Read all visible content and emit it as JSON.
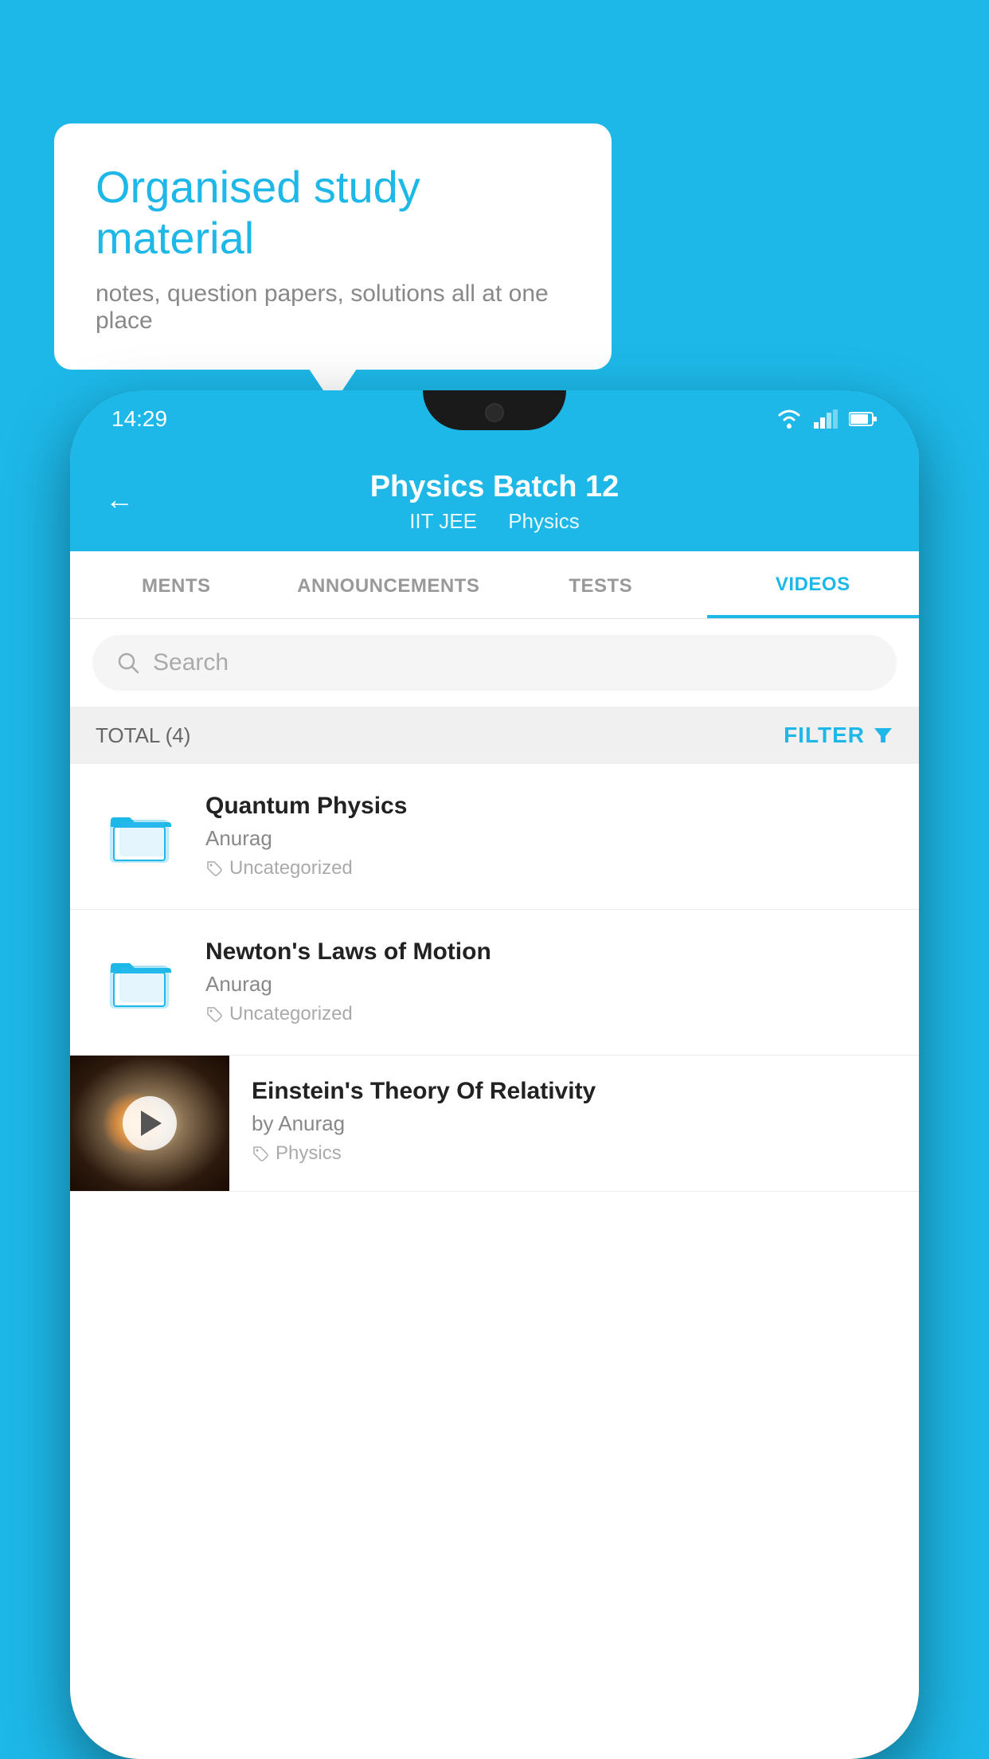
{
  "background_color": "#1db8e8",
  "speech_bubble": {
    "title": "Organised study material",
    "subtitle": "notes, question papers, solutions all at one place"
  },
  "status_bar": {
    "time": "14:29",
    "wifi_icon": "wifi",
    "signal_icon": "signal",
    "battery_icon": "battery"
  },
  "header": {
    "back_label": "←",
    "title": "Physics Batch 12",
    "subtitle_left": "IIT JEE",
    "subtitle_right": "Physics"
  },
  "tabs": [
    {
      "label": "MENTS",
      "active": false
    },
    {
      "label": "ANNOUNCEMENTS",
      "active": false
    },
    {
      "label": "TESTS",
      "active": false
    },
    {
      "label": "VIDEOS",
      "active": true
    }
  ],
  "search": {
    "placeholder": "Search"
  },
  "filter_row": {
    "total_label": "TOTAL (4)",
    "filter_label": "FILTER"
  },
  "videos": [
    {
      "id": 1,
      "title": "Quantum Physics",
      "author": "Anurag",
      "tag": "Uncategorized",
      "has_thumbnail": false
    },
    {
      "id": 2,
      "title": "Newton's Laws of Motion",
      "author": "Anurag",
      "tag": "Uncategorized",
      "has_thumbnail": false
    },
    {
      "id": 3,
      "title": "Einstein's Theory Of Relativity",
      "author": "by Anurag",
      "tag": "Physics",
      "has_thumbnail": true
    }
  ]
}
